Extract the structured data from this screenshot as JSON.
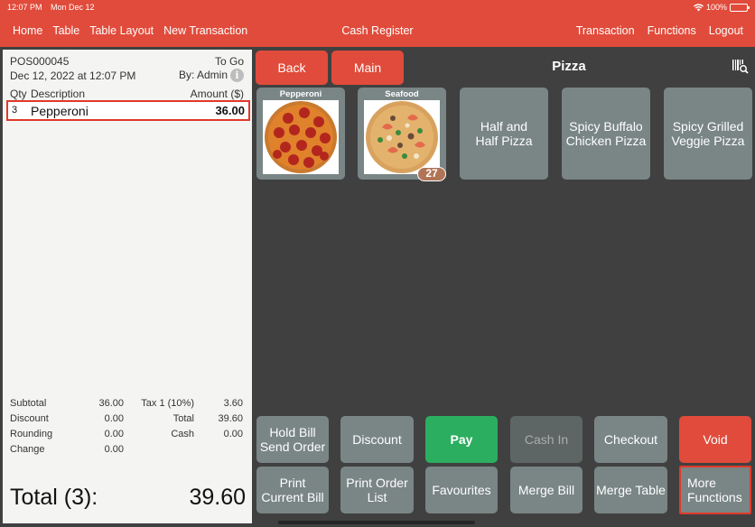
{
  "status_bar": {
    "time": "12:07 PM",
    "date": "Mon Dec 12",
    "battery": "100%"
  },
  "nav": {
    "left": [
      "Home",
      "Table",
      "Table Layout",
      "New Transaction"
    ],
    "title": "Cash Register",
    "right": [
      "Transaction",
      "Functions",
      "Logout"
    ]
  },
  "receipt": {
    "order_no": "POS000045",
    "order_type": "To Go",
    "datetime": "Dec 12, 2022 at 12:07 PM",
    "by": "By: Admin",
    "headers": {
      "qty": "Qty",
      "description": "Description",
      "amount": "Amount ($)"
    },
    "items": [
      {
        "qty": "3",
        "description": "Pepperoni",
        "amount": "36.00"
      }
    ],
    "summary": [
      {
        "l1": "Subtotal",
        "v1": "36.00",
        "l2": "Tax 1 (10%)",
        "v2": "3.60"
      },
      {
        "l1": "Discount",
        "v1": "0.00",
        "l2": "Total",
        "v2": "39.60"
      },
      {
        "l1": "Rounding",
        "v1": "0.00",
        "l2": "Cash",
        "v2": "0.00"
      },
      {
        "l1": "Change",
        "v1": "0.00",
        "l2": "",
        "v2": ""
      }
    ],
    "grand_total_label": "Total (3):",
    "grand_total_value": "39.60"
  },
  "category": {
    "back": "Back",
    "main": "Main",
    "title": "Pizza",
    "products": [
      {
        "name": "Pepperoni",
        "badge": ""
      },
      {
        "name": "Seafood",
        "badge": "27"
      },
      {
        "name": "Half and Half Pizza"
      },
      {
        "name": "Spicy Buffalo Chicken Pizza"
      },
      {
        "name": "Spicy Grilled Veggie Pizza"
      }
    ]
  },
  "actions": {
    "row1": [
      "Hold Bill Send Order",
      "Discount",
      "Pay",
      "Cash In",
      "Checkout",
      "Void"
    ],
    "row2": [
      "Print Current Bill",
      "Print Order List",
      "Favourites",
      "Merge Bill",
      "Merge Table",
      "More Functions"
    ]
  },
  "colors": {
    "brand": "#e14b3b",
    "pay": "#2bae5f",
    "tile": "#7a8585",
    "background": "#404040",
    "highlight": "#e0392b"
  },
  "icons": {
    "status": [
      "wifi-icon",
      "battery-icon"
    ],
    "toolbar": [
      "barcode-search-icon"
    ],
    "receipt": [
      "info-icon"
    ]
  }
}
